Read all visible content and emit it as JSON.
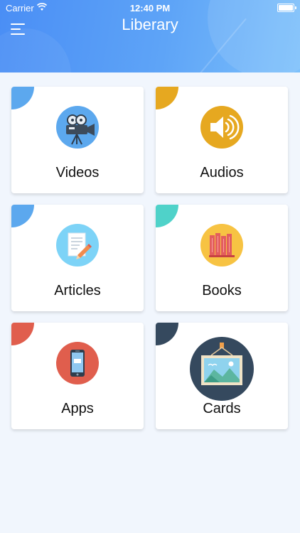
{
  "status_bar": {
    "carrier": "Carrier",
    "time": "12:40 PM"
  },
  "header": {
    "title": "Liberary"
  },
  "cards": [
    {
      "label": "Videos",
      "icon": "video-camera-icon",
      "accent": "#5ca8ee",
      "icon_bg": "#5ca8ee"
    },
    {
      "label": "Audios",
      "icon": "speaker-icon",
      "accent": "#e6a820",
      "icon_bg": "#e6a820"
    },
    {
      "label": "Articles",
      "icon": "document-pencil-icon",
      "accent": "#5ca8ee",
      "icon_bg": "#7dd3f7"
    },
    {
      "label": "Books",
      "icon": "books-icon",
      "accent": "#4fd2c9",
      "icon_bg": "#f7c343"
    },
    {
      "label": "Apps",
      "icon": "smartphone-icon",
      "accent": "#e05e4d",
      "icon_bg": "#e05e4d"
    },
    {
      "label": "Cards",
      "icon": "picture-frame-icon",
      "accent": "#35495e",
      "icon_bg": "#35495e"
    }
  ]
}
